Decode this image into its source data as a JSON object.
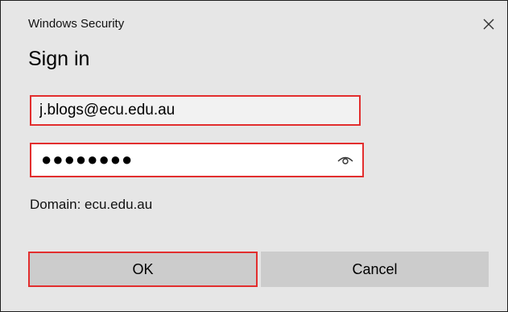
{
  "window": {
    "title": "Windows Security",
    "close_icon": "close-icon"
  },
  "dialog": {
    "heading": "Sign in",
    "email": {
      "value": "j.blogs@ecu.edu.au",
      "placeholder": ""
    },
    "password": {
      "masked_value": "●●●●●●●●",
      "reveal_icon": "eye-icon"
    },
    "domain_text": "Domain: ecu.edu.au"
  },
  "buttons": {
    "ok_label": "OK",
    "cancel_label": "Cancel"
  },
  "colors": {
    "highlight_border": "#e22e2e",
    "dialog_background": "#e6e6e6",
    "button_background": "#cccccc"
  }
}
